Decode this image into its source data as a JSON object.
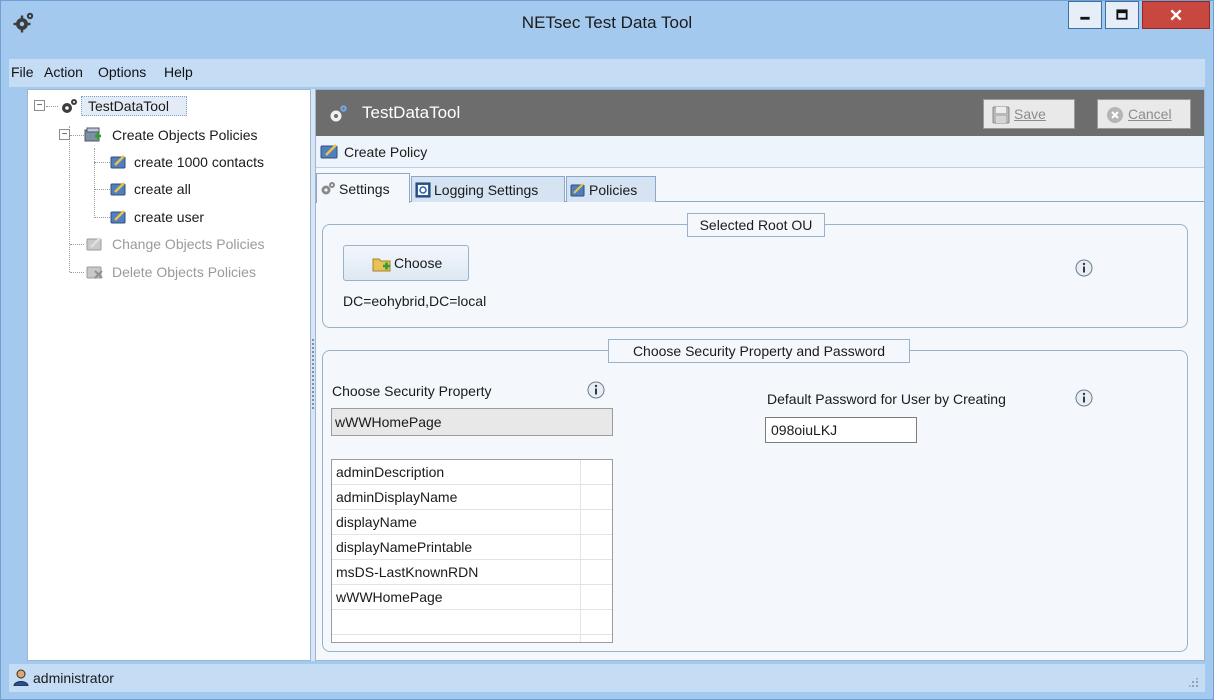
{
  "window": {
    "title": "NETsec Test Data Tool"
  },
  "menu": {
    "items": [
      "File",
      "Action",
      "Options",
      "Help"
    ]
  },
  "tree": {
    "root": "TestDataTool",
    "nodes": {
      "create_objects": "Create Objects Policies",
      "create_1000": "create 1000 contacts",
      "create_all": "create all",
      "create_user": "create user",
      "change_objects": "Change Objects Policies",
      "delete_objects": "Delete Objects Policies"
    }
  },
  "header": {
    "title": "TestDataTool",
    "save_label": "Save",
    "cancel_label": "Cancel"
  },
  "action_bar": {
    "create_policy": "Create Policy"
  },
  "tabs": {
    "settings": "Settings",
    "logging": "Logging Settings",
    "policies": "Policies"
  },
  "root_ou": {
    "legend": "Selected Root OU",
    "choose_label": "Choose",
    "value": "DC=eohybrid,DC=local"
  },
  "security": {
    "legend": "Choose Security Property and Password",
    "property_label": "Choose Security Property",
    "selected_property": "wWWHomePage",
    "properties": [
      "adminDescription",
      "adminDisplayName",
      "displayName",
      "displayNamePrintable",
      "msDS-LastKnownRDN",
      "wWWHomePage"
    ],
    "password_label": "Default Password for User by Creating",
    "password_value": "098oiuLKJ"
  },
  "status": {
    "user": "administrator"
  },
  "colors": {
    "chrome": "#a4c9ef",
    "menubar": "#c5dcf5",
    "header": "#6d6d6d",
    "close_button": "#c8473f"
  }
}
